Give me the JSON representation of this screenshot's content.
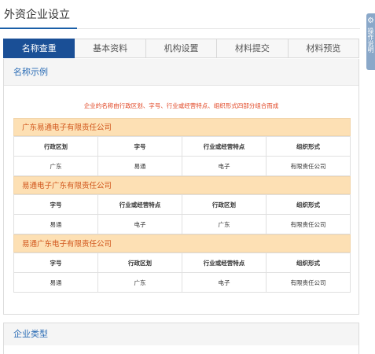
{
  "page": {
    "title": "外资企业设立"
  },
  "tabs": [
    {
      "label": "名称查重",
      "active": true
    },
    {
      "label": "基本资料",
      "active": false
    },
    {
      "label": "机构设置",
      "active": false
    },
    {
      "label": "材料提交",
      "active": false
    },
    {
      "label": "材料预览",
      "active": false
    }
  ],
  "right_handle": {
    "text": "操作说明",
    "icon": "gear-icon"
  },
  "name_example": {
    "heading": "名称示例",
    "hint": "企业的名称由行政区划、字号、行业或经营特点、组织形式四部分组合而成",
    "examples": [
      {
        "title": "广东易通电子有限责任公司",
        "headers": [
          "行政区划",
          "字号",
          "行业或经营特点",
          "组织形式"
        ],
        "values": [
          "广东",
          "易通",
          "电子",
          "有限责任公司"
        ]
      },
      {
        "title": "易通电子广东有限责任公司",
        "headers": [
          "字号",
          "行业或经营特点",
          "行政区划",
          "组织形式"
        ],
        "values": [
          "易通",
          "电子",
          "广东",
          "有限责任公司"
        ]
      },
      {
        "title": "易通广东电子有限责任公司",
        "headers": [
          "字号",
          "行政区划",
          "行业或经营特点",
          "组织形式"
        ],
        "values": [
          "易通",
          "广东",
          "电子",
          "有限责任公司"
        ]
      }
    ]
  },
  "enterprise_type": {
    "heading": "企业类型"
  },
  "colors": {
    "accent": "#1a4f96",
    "hint": "#e0421f",
    "example_bg": "#fde0b4",
    "example_text": "#d2581e"
  }
}
